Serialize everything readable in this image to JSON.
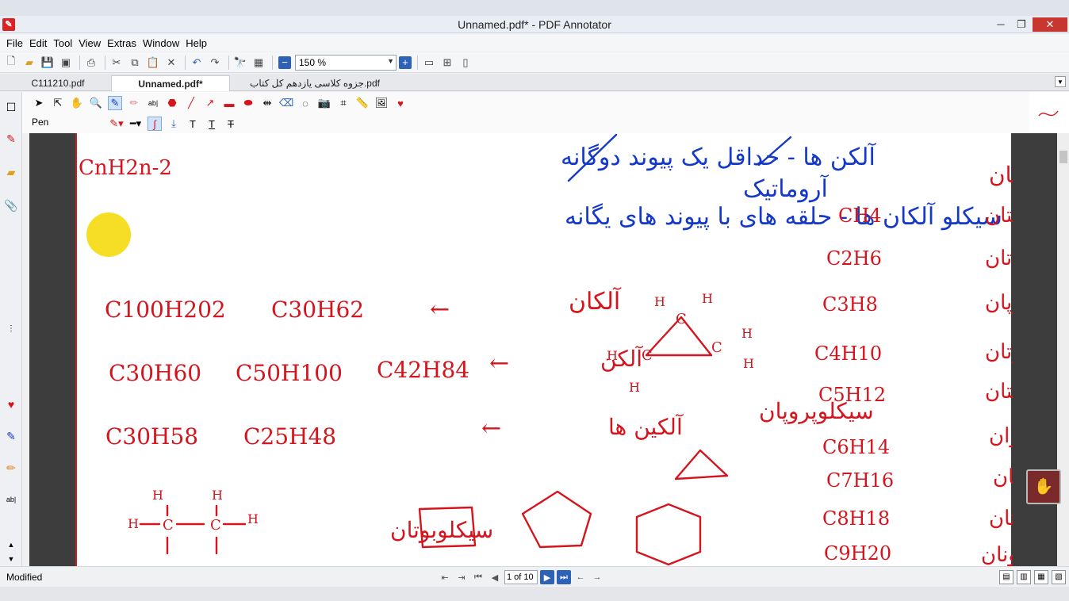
{
  "window": {
    "title": "Unnamed.pdf* - PDF Annotator",
    "min_glyph": "─",
    "max_glyph": "❐",
    "close_glyph": "✕"
  },
  "menu": [
    "File",
    "Edit",
    "Tool",
    "View",
    "Extras",
    "Window",
    "Help"
  ],
  "toolbar": {
    "zoom_value": "150 %"
  },
  "tabs": [
    {
      "label": "C111210.pdf"
    },
    {
      "label": "Unnamed.pdf*"
    },
    {
      "label": "جزوه کلاسی یازدهم کل کتاب.pdf"
    }
  ],
  "annot_toolbar": {
    "tool_name": "Pen"
  },
  "status": {
    "text": "Modified",
    "page_indicator": "1 of 10"
  },
  "colors": {
    "ink_red": "#d5151d",
    "ink_blue": "#1438c9",
    "highlight": "#f5d800",
    "accent": "#2e62b8"
  },
  "document": {
    "blue_line1": "آلکن ها - حداقل یک پیوند دوگانه",
    "blue_line2": "سیکلو آلکان ها - حلقه های با پیوند های یگانه",
    "blue_aromatic": "آروماتیک",
    "red_general_formula": "CnH2n-2",
    "right_header": "نام آلکان",
    "alkanes": [
      {
        "name": "متان",
        "formula": "CH4"
      },
      {
        "name": "اتان",
        "formula": "C2H6"
      },
      {
        "name": "پروپان",
        "formula": "C3H8"
      },
      {
        "name": "بوتان",
        "formula": "C4H10"
      },
      {
        "name": "پنتان",
        "formula": "C5H12"
      },
      {
        "name": "هگزان",
        "formula": "C6H14"
      },
      {
        "name": "هپتان",
        "formula": "C7H16"
      },
      {
        "name": "اوکتان",
        "formula": "C8H18"
      },
      {
        "name": "نونان",
        "formula": "C9H20"
      }
    ],
    "row1": [
      "C100H202",
      "C30H62",
      "←",
      "آلکان"
    ],
    "row2": [
      "C30H60",
      "C50H100",
      "C42H84",
      "←",
      "آلکن"
    ],
    "row3": [
      "C30H58",
      "C25H48",
      "←",
      "آلکین ها"
    ],
    "cyclopropane_label": "سیکلوپروپان",
    "cyclobutane_label": "سیکلوبوتان"
  }
}
